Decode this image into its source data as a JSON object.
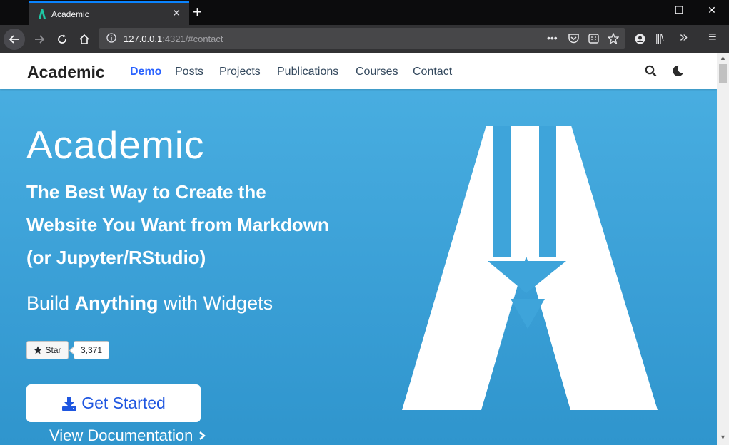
{
  "browser": {
    "tab_title": "Academic",
    "tab_close": "✕",
    "new_tab": "+",
    "window_controls": {
      "minimize": "—",
      "maximize": "☐",
      "close": "✕"
    },
    "url_host": "127.0.0.1",
    "url_rest": ":4321/#contact",
    "toolbar_icons": [
      "page-actions-icon",
      "pocket-icon",
      "reader-icon",
      "bookmark-star-icon",
      "account-icon",
      "library-icon",
      "overflow-icon",
      "menu-icon"
    ],
    "labels": {
      "more": "•••",
      "overflow": "»",
      "menu": "≡",
      "library": "|||\\"
    }
  },
  "site": {
    "brand": "Academic",
    "menu": [
      "Demo",
      "Posts",
      "Projects",
      "Publications",
      "Courses",
      "Contact"
    ],
    "active_menu": "Demo"
  },
  "hero": {
    "title": "Academic",
    "subtitle_lines": [
      "The Best Way to Create the",
      "Website You Want from Markdown",
      "(or Jupyter/RStudio)"
    ],
    "tagline_pre": "Build ",
    "tagline_bold": "Anything",
    "tagline_post": " with Widgets",
    "star_label": "Star",
    "star_count": "3,371",
    "get_started": "Get Started",
    "view_docs": "View Documentation"
  },
  "colors": {
    "accent": "#2962ff",
    "hero_bg": "#3a9fd6",
    "chrome_bg": "#323234"
  }
}
